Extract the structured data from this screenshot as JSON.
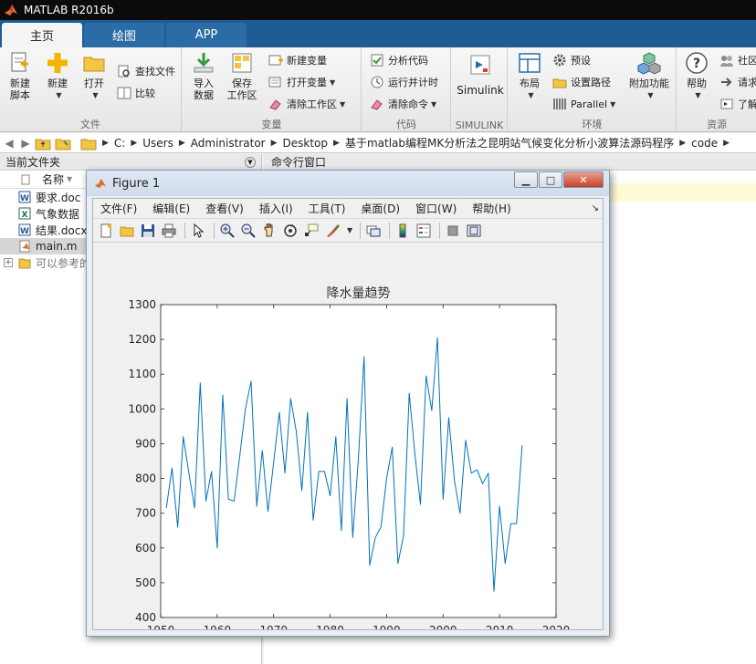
{
  "app": {
    "title": "MATLAB R2016b"
  },
  "ribbon_tabs": [
    {
      "label": "主页",
      "active": true
    },
    {
      "label": "绘图",
      "active": false
    },
    {
      "label": "APP",
      "active": false
    }
  ],
  "ribbon": {
    "file_group": {
      "label": "文件",
      "new_script": "新建\n脚本",
      "new": "新建",
      "open": "打开",
      "find_files": "查找文件",
      "compare": "比较"
    },
    "variable_group": {
      "label": "变量",
      "import_data": "导入\n数据",
      "save_workspace": "保存\n工作区",
      "new_variable": "新建变量",
      "open_variable": "打开变量",
      "clear_workspace": "清除工作区"
    },
    "code_group": {
      "label": "代码",
      "analyze_code": "分析代码",
      "run_and_time": "运行并计时",
      "clear_commands": "清除命令"
    },
    "simulink_group": {
      "label": "SIMULINK",
      "simulink": "Simulink"
    },
    "environment_group": {
      "label": "环境",
      "layout": "布局",
      "preferences": "预设",
      "set_path": "设置路径",
      "parallel": "Parallel",
      "addons": "附加功能"
    },
    "resources_group": {
      "label": "资源",
      "help": "帮助",
      "community": "社区",
      "request": "请求",
      "learn": "了解"
    }
  },
  "address": {
    "crumbs": [
      "C:",
      "Users",
      "Administrator",
      "Desktop",
      "基于matlab编程MK分析法之昆明站气候变化分析小波算法源码程序",
      "code"
    ]
  },
  "left_panel": {
    "title": "当前文件夹",
    "column_name": "名称",
    "files": [
      {
        "name": "要求.doc",
        "type": "word",
        "selected": false
      },
      {
        "name": "气象数据",
        "type": "excel",
        "selected": false
      },
      {
        "name": "结果.docx",
        "type": "word",
        "selected": false
      },
      {
        "name": "main.m",
        "type": "m",
        "selected": true
      },
      {
        "name": "可以参考的",
        "type": "folder",
        "selected": false
      }
    ]
  },
  "right_panel": {
    "title": "命令行窗口"
  },
  "figure": {
    "title": "Figure 1",
    "menu": [
      "文件(F)",
      "编辑(E)",
      "查看(V)",
      "插入(I)",
      "工具(T)",
      "桌面(D)",
      "窗口(W)",
      "帮助(H)"
    ],
    "toolbar_icons": [
      "new-figure-icon",
      "open-icon",
      "save-icon",
      "print-icon",
      "pointer-icon",
      "zoom-in-icon",
      "zoom-out-icon",
      "pan-icon",
      "rotate-icon",
      "data-cursor-icon",
      "brush-icon",
      "link-icon",
      "colorbar-icon",
      "legend-icon",
      "hide-plot-tools-icon",
      "show-plot-tools-icon"
    ]
  },
  "chart_data": {
    "type": "line",
    "title": "降水量趋势",
    "xlabel": "",
    "ylabel": "",
    "xlim": [
      1950,
      2020
    ],
    "ylim": [
      400,
      1300
    ],
    "xticks": [
      1950,
      1960,
      1970,
      1980,
      1990,
      2000,
      2010,
      2020
    ],
    "yticks": [
      400,
      500,
      600,
      700,
      800,
      900,
      1000,
      1100,
      1200,
      1300
    ],
    "grid": false,
    "line_color": "#0072bd",
    "series": [
      {
        "x": [
          1951,
          1952,
          1953,
          1954,
          1955,
          1956,
          1957,
          1958,
          1959,
          1960,
          1961,
          1962,
          1963,
          1964,
          1965,
          1966,
          1967,
          1968,
          1969,
          1970,
          1971,
          1972,
          1973,
          1974,
          1975,
          1976,
          1977,
          1978,
          1979,
          1980,
          1981,
          1982,
          1983,
          1984,
          1985,
          1986,
          1987,
          1988,
          1989,
          1990,
          1991,
          1992,
          1993,
          1994,
          1995,
          1996,
          1997,
          1998,
          1999,
          2000,
          2001,
          2002,
          2003,
          2004,
          2005,
          2006,
          2007,
          2008,
          2009,
          2010,
          2011,
          2012,
          2013,
          2014
        ],
        "values": [
          715,
          830,
          660,
          920,
          815,
          715,
          1075,
          735,
          820,
          600,
          1040,
          740,
          735,
          865,
          1000,
          1080,
          720,
          880,
          705,
          845,
          990,
          815,
          1030,
          935,
          765,
          990,
          680,
          820,
          820,
          750,
          920,
          650,
          1030,
          630,
          855,
          1150,
          550,
          630,
          660,
          800,
          890,
          555,
          635,
          1045,
          870,
          725,
          1095,
          995,
          1205,
          740,
          975,
          795,
          700,
          910,
          815,
          825,
          785,
          815,
          475,
          720,
          555,
          670,
          670,
          895
        ]
      }
    ]
  }
}
